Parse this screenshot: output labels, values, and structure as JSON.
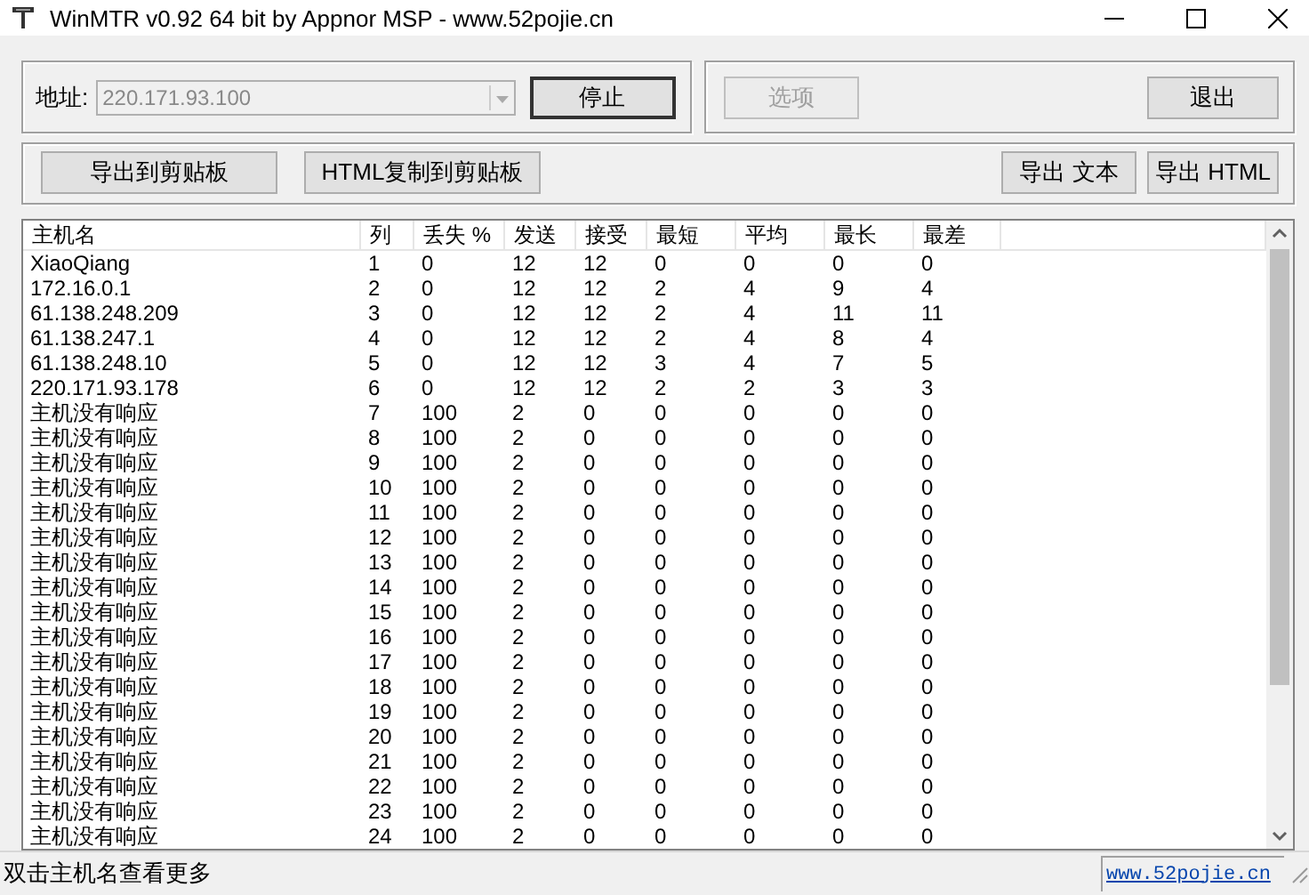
{
  "window": {
    "title": "WinMTR v0.92 64 bit by Appnor MSP - www.52pojie.cn"
  },
  "address": {
    "label": "地址:",
    "value": "220.171.93.100",
    "disabled": true
  },
  "top_buttons": [
    {
      "label": "停止",
      "disabled": false,
      "default": true
    },
    {
      "label": "选项",
      "disabled": true,
      "default": false
    },
    {
      "label": "退出",
      "disabled": false,
      "default": false
    }
  ],
  "export_buttons": [
    {
      "label": "导出到剪贴板"
    },
    {
      "label": "HTML复制到剪贴板"
    },
    {
      "label": "导出 文本"
    },
    {
      "label": "导出 HTML"
    }
  ],
  "table": {
    "columns": [
      "主机名",
      "列",
      "丢失 %",
      "发送",
      "接受",
      "最短",
      "平均",
      "最长",
      "最差"
    ],
    "rows": [
      [
        "XiaoQiang",
        "1",
        "0",
        "12",
        "12",
        "0",
        "0",
        "0",
        "0"
      ],
      [
        "172.16.0.1",
        "2",
        "0",
        "12",
        "12",
        "2",
        "4",
        "9",
        "4"
      ],
      [
        "61.138.248.209",
        "3",
        "0",
        "12",
        "12",
        "2",
        "4",
        "11",
        "11"
      ],
      [
        "61.138.247.1",
        "4",
        "0",
        "12",
        "12",
        "2",
        "4",
        "8",
        "4"
      ],
      [
        "61.138.248.10",
        "5",
        "0",
        "12",
        "12",
        "3",
        "4",
        "7",
        "5"
      ],
      [
        "220.171.93.178",
        "6",
        "0",
        "12",
        "12",
        "2",
        "2",
        "3",
        "3"
      ],
      [
        "主机没有响应",
        "7",
        "100",
        "2",
        "0",
        "0",
        "0",
        "0",
        "0"
      ],
      [
        "主机没有响应",
        "8",
        "100",
        "2",
        "0",
        "0",
        "0",
        "0",
        "0"
      ],
      [
        "主机没有响应",
        "9",
        "100",
        "2",
        "0",
        "0",
        "0",
        "0",
        "0"
      ],
      [
        "主机没有响应",
        "10",
        "100",
        "2",
        "0",
        "0",
        "0",
        "0",
        "0"
      ],
      [
        "主机没有响应",
        "11",
        "100",
        "2",
        "0",
        "0",
        "0",
        "0",
        "0"
      ],
      [
        "主机没有响应",
        "12",
        "100",
        "2",
        "0",
        "0",
        "0",
        "0",
        "0"
      ],
      [
        "主机没有响应",
        "13",
        "100",
        "2",
        "0",
        "0",
        "0",
        "0",
        "0"
      ],
      [
        "主机没有响应",
        "14",
        "100",
        "2",
        "0",
        "0",
        "0",
        "0",
        "0"
      ],
      [
        "主机没有响应",
        "15",
        "100",
        "2",
        "0",
        "0",
        "0",
        "0",
        "0"
      ],
      [
        "主机没有响应",
        "16",
        "100",
        "2",
        "0",
        "0",
        "0",
        "0",
        "0"
      ],
      [
        "主机没有响应",
        "17",
        "100",
        "2",
        "0",
        "0",
        "0",
        "0",
        "0"
      ],
      [
        "主机没有响应",
        "18",
        "100",
        "2",
        "0",
        "0",
        "0",
        "0",
        "0"
      ],
      [
        "主机没有响应",
        "19",
        "100",
        "2",
        "0",
        "0",
        "0",
        "0",
        "0"
      ],
      [
        "主机没有响应",
        "20",
        "100",
        "2",
        "0",
        "0",
        "0",
        "0",
        "0"
      ],
      [
        "主机没有响应",
        "21",
        "100",
        "2",
        "0",
        "0",
        "0",
        "0",
        "0"
      ],
      [
        "主机没有响应",
        "22",
        "100",
        "2",
        "0",
        "0",
        "0",
        "0",
        "0"
      ],
      [
        "主机没有响应",
        "23",
        "100",
        "2",
        "0",
        "0",
        "0",
        "0",
        "0"
      ],
      [
        "主机没有响应",
        "24",
        "100",
        "2",
        "0",
        "0",
        "0",
        "0",
        "0"
      ]
    ]
  },
  "status_bar": {
    "text": "双击主机名查看更多",
    "link": "www.52pojie.cn"
  }
}
